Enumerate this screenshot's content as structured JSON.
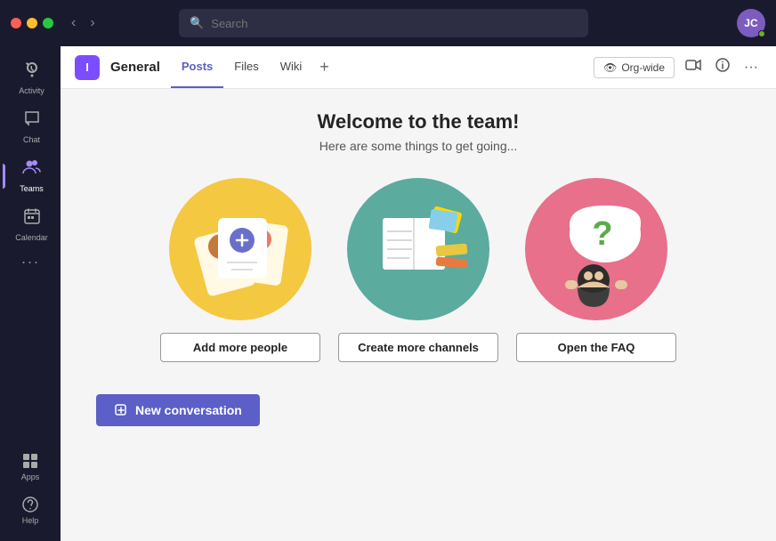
{
  "titlebar": {
    "search_placeholder": "Search",
    "back_btn": "‹",
    "forward_btn": "›",
    "avatar_initials": "JC"
  },
  "sidebar": {
    "items": [
      {
        "id": "activity",
        "label": "Activity",
        "icon": "🔔",
        "active": false
      },
      {
        "id": "chat",
        "label": "Chat",
        "icon": "💬",
        "active": false
      },
      {
        "id": "teams",
        "label": "Teams",
        "icon": "👥",
        "active": true
      }
    ],
    "calendar_label": "Calendar",
    "apps_label": "Apps",
    "help_label": "Help",
    "more_dots": "···"
  },
  "channel": {
    "team_icon": "I",
    "name": "General",
    "tabs": [
      {
        "label": "Posts",
        "active": true
      },
      {
        "label": "Files",
        "active": false
      },
      {
        "label": "Wiki",
        "active": false
      }
    ],
    "add_tab": "+",
    "org_wide_label": "Org-wide",
    "info_icon": "ⓘ",
    "more_icon": "···"
  },
  "main": {
    "welcome_title": "Welcome to the team!",
    "welcome_subtitle": "Here are some things to get going...",
    "cards": [
      {
        "id": "add-people",
        "btn_label": "Add more people",
        "color": "yellow"
      },
      {
        "id": "create-channels",
        "btn_label": "Create more channels",
        "color": "teal"
      },
      {
        "id": "open-faq",
        "btn_label": "Open the FAQ",
        "color": "pink"
      }
    ],
    "new_conversation_label": "New conversation"
  }
}
